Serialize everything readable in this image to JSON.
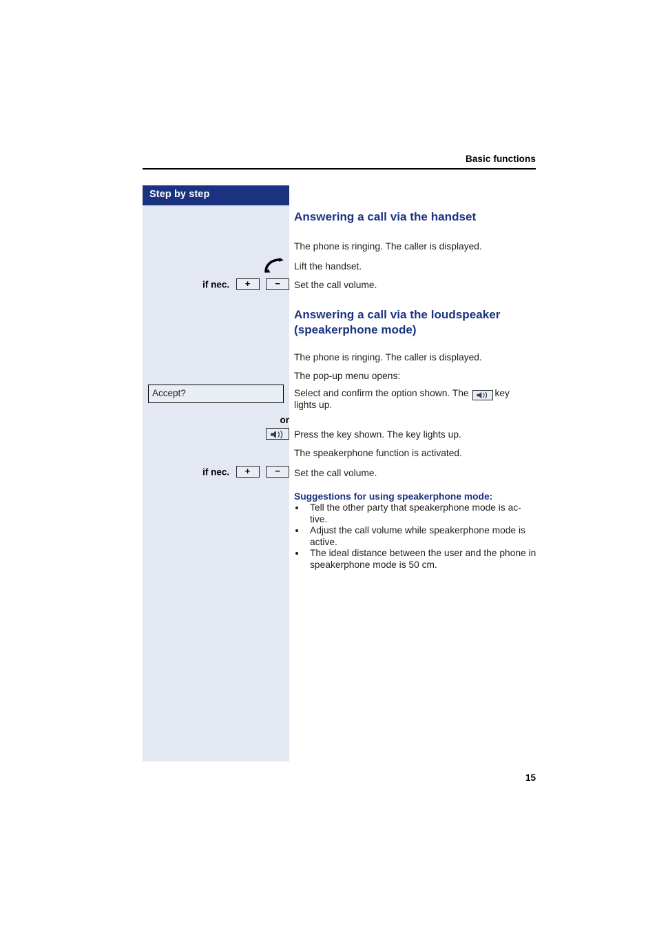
{
  "header": {
    "running_title": "Basic functions"
  },
  "sidebar": {
    "title": "Step by step",
    "background_color": "#e4e8f2",
    "header_color": "#1b3281",
    "gutter_items": [
      {
        "id": "lift-handset",
        "icon": "handset-lift-icon",
        "prefix": ""
      },
      {
        "id": "volume-handset",
        "prefix": "if nec.",
        "keys": [
          "+",
          "−"
        ]
      },
      {
        "id": "accept-popup",
        "display_text": "Accept?"
      },
      {
        "id": "or-separator",
        "label": "or"
      },
      {
        "id": "speaker-key",
        "icon": "loudspeaker-key-icon"
      },
      {
        "id": "volume-speaker",
        "prefix": "if nec.",
        "keys": [
          "+",
          "−"
        ]
      }
    ]
  },
  "content": {
    "heading_1": "Answering a call via the handset",
    "heading_2_line1": "Answering a call via the loudspeaker",
    "heading_2_line2": "(speakerphone mode)",
    "heading_color": "#1b3281",
    "p_ringing_1": "The phone is ringing. The caller is displayed.",
    "p_lift_handset": "Lift the handset.",
    "p_set_volume_1": "Set the call volume.",
    "p_ringing_2": "The phone is ringing. The caller is displayed.",
    "p_popup_opens": "The pop-up menu opens:",
    "p_select_confirm_before": "Select and confirm the option shown. The",
    "p_select_confirm_after": "key",
    "p_select_confirm_line2": "lights up.",
    "p_press_key": "Press the key shown. The key lights up.",
    "p_speakerphone_activated": "The speakerphone function is activated.",
    "p_set_volume_2": "Set the call volume.",
    "suggestions_title": "Suggestions for using speakerphone mode:",
    "bullets": [
      "Tell the other party that speakerphone mode is ac-​tive.",
      "Adjust the call volume while speakerphone mode is active.",
      "The ideal distance between the user and the phone in speakerphone mode is 50 cm."
    ]
  },
  "footer": {
    "page_number": "15"
  }
}
